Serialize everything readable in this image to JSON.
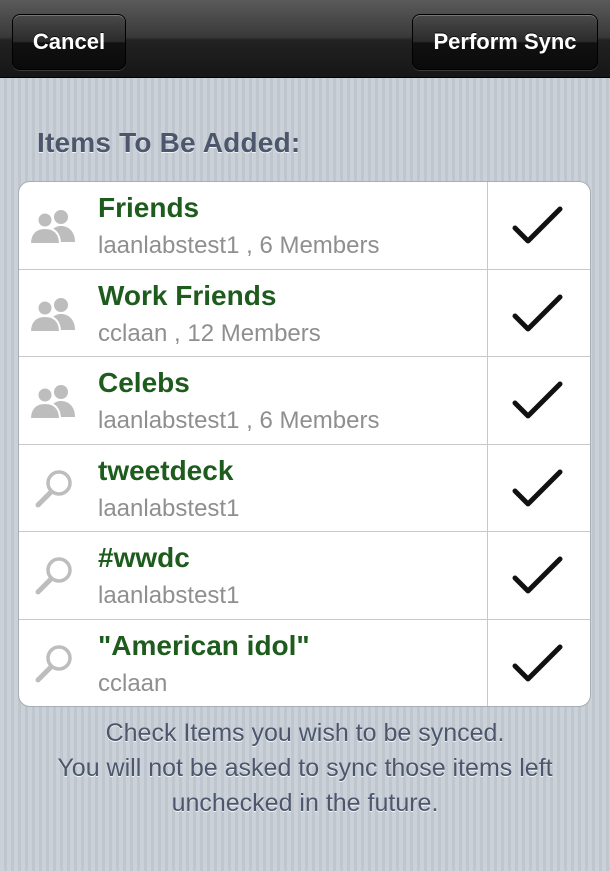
{
  "navbar": {
    "cancel_label": "Cancel",
    "sync_label": "Perform Sync"
  },
  "section": {
    "title": "Items To Be Added:"
  },
  "items": [
    {
      "icon": "group-icon",
      "title": "Friends",
      "subtitle": "laanlabstest1 , 6 Members",
      "checked": true
    },
    {
      "icon": "group-icon",
      "title": "Work Friends",
      "subtitle": "cclaan , 12 Members",
      "checked": true
    },
    {
      "icon": "group-icon",
      "title": "Celebs",
      "subtitle": "laanlabstest1 , 6 Members",
      "checked": true
    },
    {
      "icon": "search-icon",
      "title": "tweetdeck",
      "subtitle": "laanlabstest1",
      "checked": true
    },
    {
      "icon": "search-icon",
      "title": "#wwdc",
      "subtitle": "laanlabstest1",
      "checked": true
    },
    {
      "icon": "search-icon",
      "title": "\"American idol\"",
      "subtitle": "cclaan",
      "checked": true
    }
  ],
  "footer": {
    "lines": [
      "Check Items you wish to be synced.",
      "You will not be asked to sync those items left",
      "unchecked in the future."
    ]
  },
  "colors": {
    "title_green": "#1d5c1d",
    "section_text": "#4c566c",
    "subtitle_gray": "#8f8f8f"
  }
}
